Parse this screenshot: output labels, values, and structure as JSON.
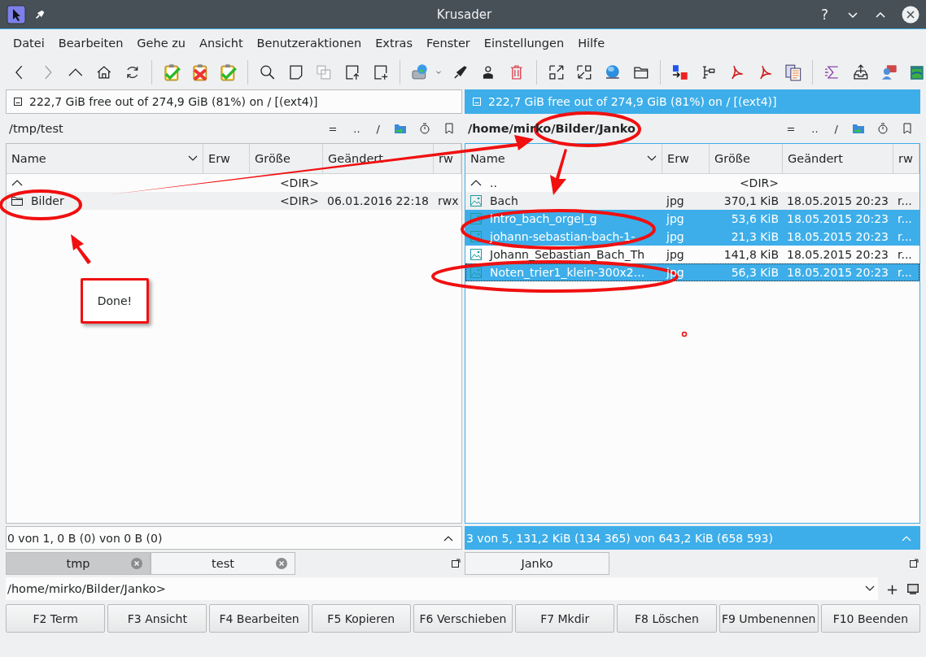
{
  "window": {
    "title": "Krusader",
    "help": "?"
  },
  "menu": [
    "Datei",
    "Bearbeiten",
    "Gehe zu",
    "Ansicht",
    "Benutzeraktionen",
    "Extras",
    "Fenster",
    "Einstellungen",
    "Hilfe"
  ],
  "panels": [
    {
      "active": false,
      "disk": "222,7 GiB free out of 274,9 GiB (81%) on / [(ext4)]",
      "path": "/tmp/test",
      "nav": [
        "=",
        "..",
        "/"
      ],
      "columns": [
        "Name",
        "Erw",
        "Größe",
        "Geändert",
        "rw"
      ],
      "rows": [
        {
          "kind": "parent",
          "name": "",
          "ext": "",
          "size": "<DIR>",
          "date": "",
          "perm": "",
          "selected": false
        },
        {
          "kind": "folder",
          "name": "Bilder",
          "ext": "",
          "size": "<DIR>",
          "date": "06.01.2016 22:18",
          "perm": "rwx",
          "selected": false
        }
      ],
      "status": "0 von 1, 0 B (0) von 0 B (0)",
      "tabs": [
        {
          "label": "tmp",
          "selected": false,
          "closable": true
        },
        {
          "label": "test",
          "selected": true,
          "closable": true
        }
      ]
    },
    {
      "active": true,
      "disk": "222,7 GiB free out of 274,9 GiB (81%) on / [(ext4)]",
      "path": "/home/mirko/Bilder/Janko",
      "nav": [
        "=",
        "..",
        "/"
      ],
      "columns": [
        "Name",
        "Erw",
        "Größe",
        "Geändert",
        "rw"
      ],
      "rows": [
        {
          "kind": "parent",
          "name": "..",
          "ext": "",
          "size": "<DIR>",
          "date": "",
          "perm": "",
          "selected": false
        },
        {
          "kind": "image",
          "name": "Bach",
          "ext": "jpg",
          "size": "370,1 KiB",
          "date": "18.05.2015 20:23",
          "perm": "r...",
          "selected": false
        },
        {
          "kind": "image",
          "name": "intro_bach_orgel_g",
          "ext": "jpg",
          "size": "53,6 KiB",
          "date": "18.05.2015 20:23",
          "perm": "r...",
          "selected": true
        },
        {
          "kind": "image",
          "name": "johann-sebastian-bach-1-",
          "ext": "jpg",
          "size": "21,3 KiB",
          "date": "18.05.2015 20:23",
          "perm": "r...",
          "selected": true
        },
        {
          "kind": "image",
          "name": "Johann_Sebastian_Bach_Th",
          "ext": "jpg",
          "size": "141,8 KiB",
          "date": "18.05.2015 20:23",
          "perm": "r...",
          "selected": false
        },
        {
          "kind": "image",
          "name": "Noten_trier1_klein-300x2...",
          "ext": "jpg",
          "size": "56,3 KiB",
          "date": "18.05.2015 20:23",
          "perm": "r...",
          "selected": true
        }
      ],
      "status": "3 von 5, 131,2 KiB (134 365) von 643,2 KiB (658 593)",
      "tabs": [
        {
          "label": "Janko",
          "selected": true,
          "closable": false
        }
      ]
    }
  ],
  "command_line": {
    "value": "/home/mirko/Bilder/Janko>",
    "add": "+"
  },
  "function_keys": [
    "F2 Term",
    "F3 Ansicht",
    "F4 Bearbeiten",
    "F5 Kopieren",
    "F6 Verschieben",
    "F7 Mkdir",
    "F8 Löschen",
    "F9 Umbenennen",
    "F10 Beenden"
  ],
  "annotations": {
    "callout": "Done!"
  }
}
